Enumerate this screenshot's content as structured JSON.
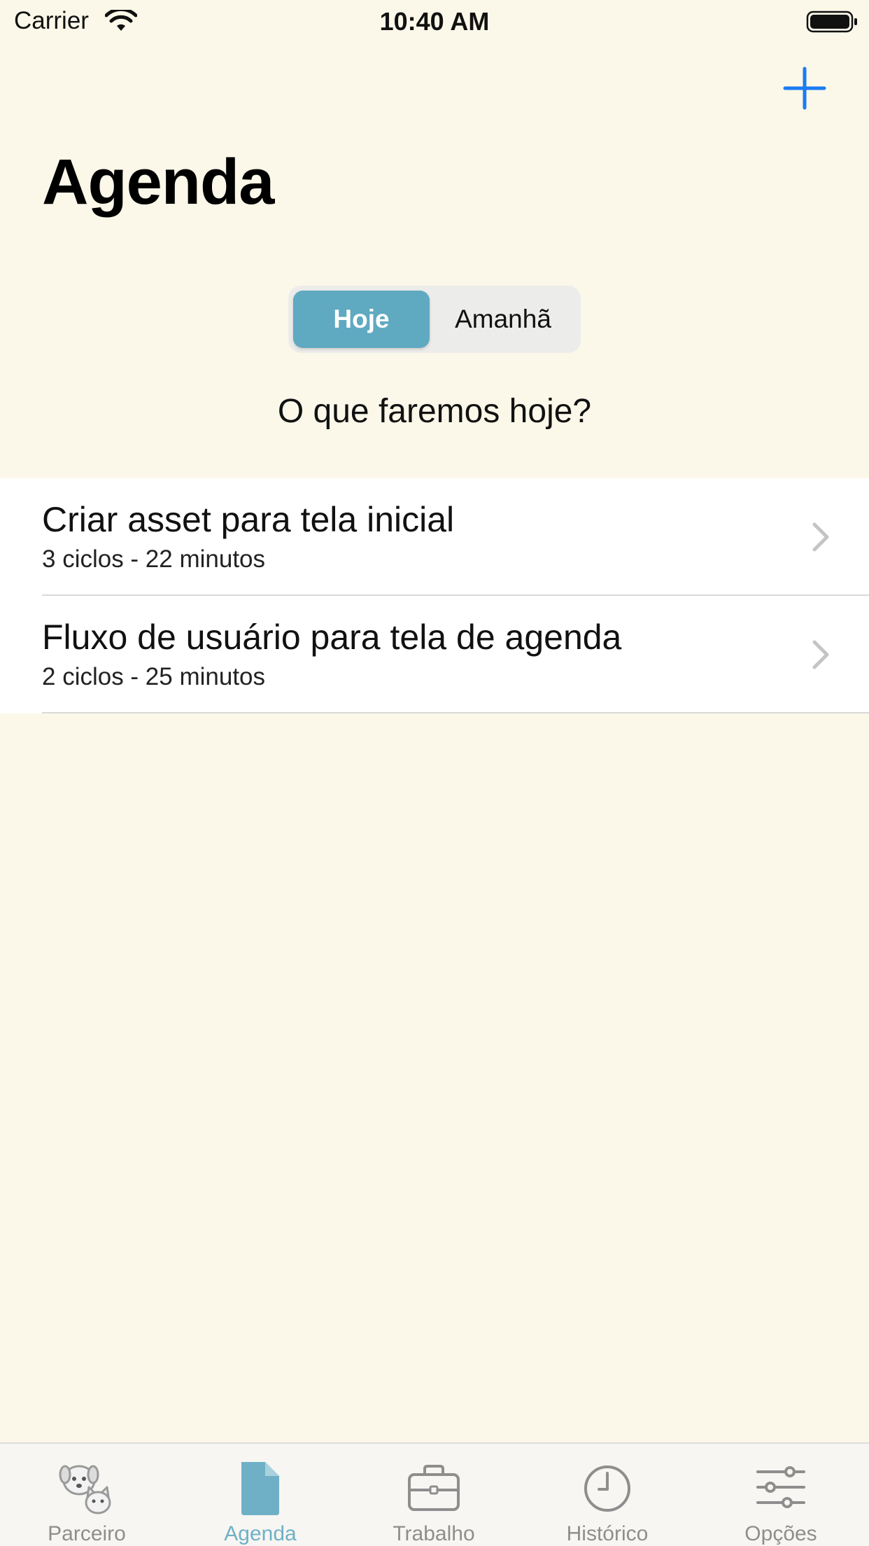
{
  "status_bar": {
    "carrier": "Carrier",
    "time": "10:40 AM"
  },
  "header": {
    "title": "Agenda",
    "add_icon": "plus-icon"
  },
  "segments": [
    {
      "label": "Hoje",
      "selected": true
    },
    {
      "label": "Amanhã",
      "selected": false
    }
  ],
  "prompt": "O que faremos hoje?",
  "tasks": [
    {
      "title": "Criar asset para tela inicial",
      "subtitle": "3 ciclos - 22 minutos"
    },
    {
      "title": "Fluxo de usuário para tela de agenda",
      "subtitle": "2 ciclos - 25 minutos"
    }
  ],
  "tabs": [
    {
      "label": "Parceiro",
      "icon": "pets-icon",
      "active": false
    },
    {
      "label": "Agenda",
      "icon": "document-icon",
      "active": true
    },
    {
      "label": "Trabalho",
      "icon": "briefcase-icon",
      "active": false
    },
    {
      "label": "Histórico",
      "icon": "clock-icon",
      "active": false
    },
    {
      "label": "Opções",
      "icon": "sliders-icon",
      "active": false
    }
  ],
  "colors": {
    "background": "#fbf8e9",
    "accent": "#5fa9c1",
    "add_button": "#1a7cf2",
    "tab_inactive": "#8e8e8e"
  }
}
